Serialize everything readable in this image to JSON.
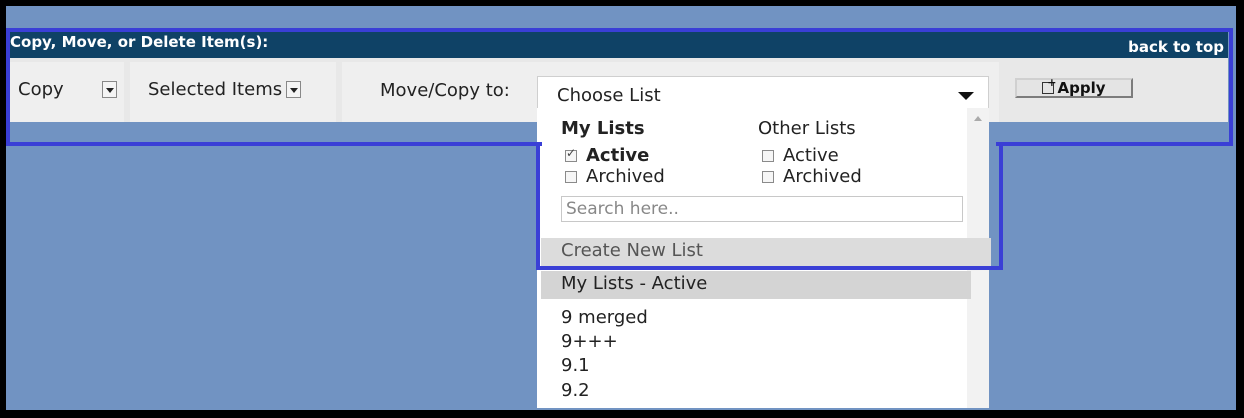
{
  "header": {
    "title": "Copy, Move, or Delete Item(s):",
    "back_to_top": "back to top"
  },
  "controls": {
    "action_select": {
      "value": "Copy"
    },
    "scope_select": {
      "value": "Selected Items"
    },
    "move_copy_label": "Move/Copy to:",
    "list_select": {
      "value": "Choose List"
    },
    "apply_label": "Apply"
  },
  "dropdown": {
    "my_lists_header": "My Lists",
    "other_lists_header": "Other Lists",
    "my_lists": [
      {
        "label": "Active",
        "checked": true
      },
      {
        "label": "Archived",
        "checked": false
      }
    ],
    "other_lists": [
      {
        "label": "Active",
        "checked": false
      },
      {
        "label": "Archived",
        "checked": false
      }
    ],
    "search_placeholder": "Search here..",
    "create_new_list": "Create New List",
    "group_header": "My Lists - Active",
    "items": [
      "9 merged",
      "9+++",
      "9.1",
      "9.2"
    ]
  },
  "colors": {
    "background": "#7193c2",
    "header_bar": "#0f4266",
    "highlight": "#3a3fd6"
  }
}
